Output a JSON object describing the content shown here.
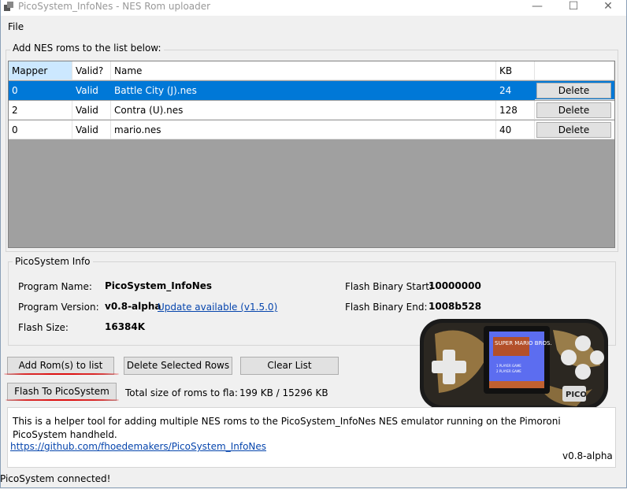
{
  "window": {
    "title": "PicoSystem_InfoNes - NES Rom uploader"
  },
  "menu": {
    "file": "File"
  },
  "rom_group": {
    "label": "Add NES roms to the list below:"
  },
  "table": {
    "headers": [
      "Mapper",
      "Valid?",
      "Name",
      "KB",
      ""
    ],
    "rows": [
      {
        "mapper": "0",
        "valid": "Valid",
        "name": "Battle City (J).nes",
        "kb": "24",
        "action": "Delete"
      },
      {
        "mapper": "2",
        "valid": "Valid",
        "name": "Contra (U).nes",
        "kb": "128",
        "action": "Delete"
      },
      {
        "mapper": "0",
        "valid": "Valid",
        "name": "mario.nes",
        "kb": "40",
        "action": "Delete"
      }
    ]
  },
  "info": {
    "label": "PicoSystem Info",
    "program_name_label": "Program Name:",
    "program_name": "PicoSystem_InfoNes",
    "program_version_label": "Program Version:",
    "program_version": "v0.8-alpha",
    "update_link": "Update available (v1.5.0)",
    "flash_size_label": "Flash Size:",
    "flash_size": "16384K",
    "flash_start_label": "Flash Binary Start:",
    "flash_start": "10000000",
    "flash_end_label": "Flash Binary End:",
    "flash_end": "1008b528"
  },
  "buttons": {
    "add_roms": "Add Rom(s) to list",
    "delete_selected": "Delete Selected Rows",
    "clear_list": "Clear List",
    "flash": "Flash To PicoSystem"
  },
  "total": {
    "label": "Total size of roms to fla:",
    "value": "199 KB / 15296 KB"
  },
  "help": {
    "text": "This is a helper tool for adding multiple NES roms to the PicoSystem_InfoNes NES emulator running on the Pimoroni PicoSystem handheld.",
    "link": "https://github.com/fhoedemakers/PicoSystem_InfoNes",
    "version": "v0.8-alpha"
  },
  "status": {
    "text": "PicoSystem connected!"
  },
  "device_image": {
    "screen_title": "SUPER MARIO BROS.",
    "screen_menu_1": "1 PLAYER GAME",
    "screen_menu_2": "2 PLAYER GAME",
    "badge": "PICO"
  },
  "colors": {
    "selection": "#0078d7",
    "link": "#0645ad",
    "annotation": "#dd1111"
  }
}
